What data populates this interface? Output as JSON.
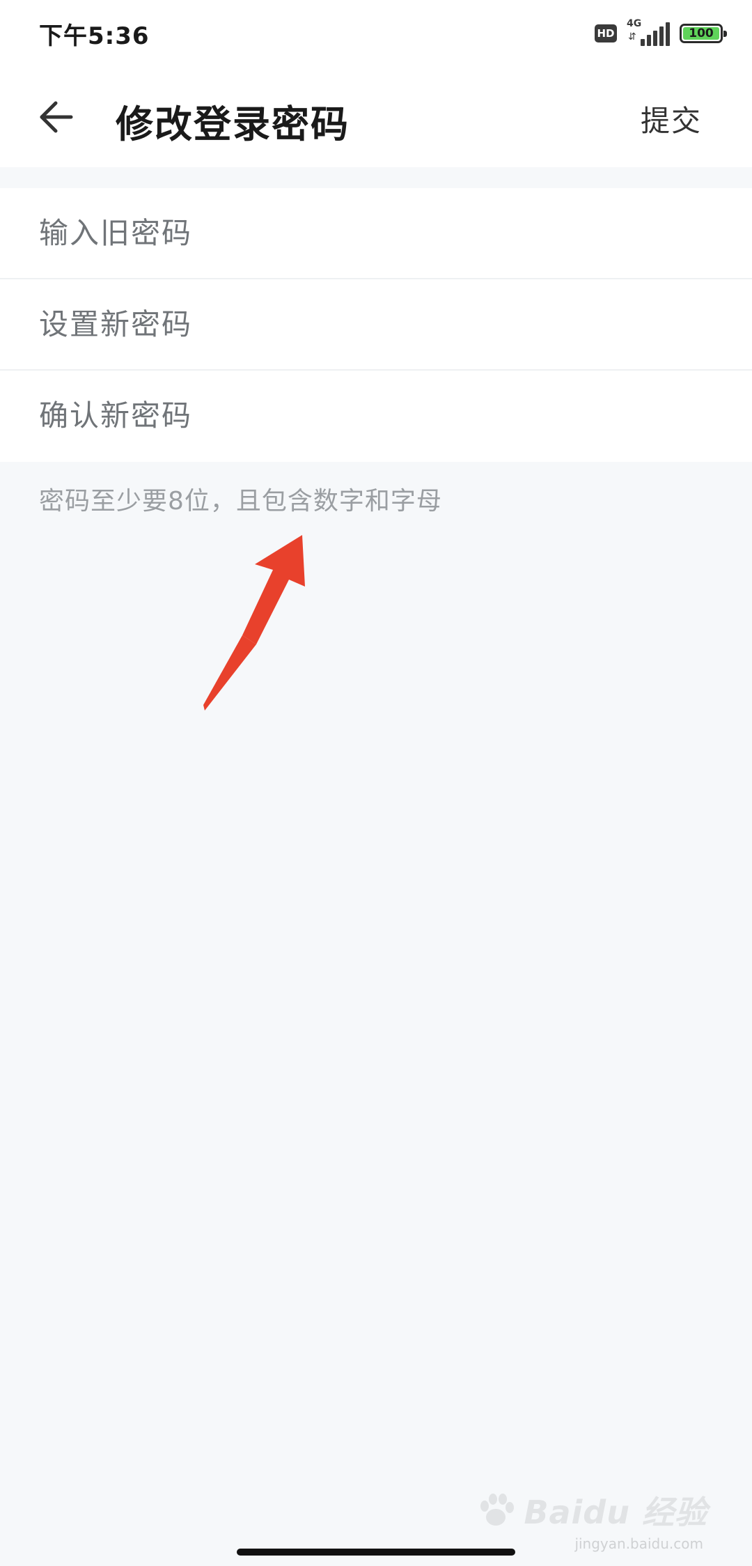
{
  "status_bar": {
    "time": "下午5:36",
    "hd_label": "HD",
    "network_label": "4G",
    "network_arrows": "⇵",
    "battery_level": "100"
  },
  "app_bar": {
    "title": "修改登录密码",
    "submit_label": "提交"
  },
  "form": {
    "old_password_placeholder": "输入旧密码",
    "new_password_placeholder": "设置新密码",
    "confirm_password_placeholder": "确认新密码"
  },
  "hint": "密码至少要8位，且包含数字和字母",
  "annotation": {
    "arrow_color": "#e8412c"
  },
  "watermark": {
    "text": "Baidu 经验",
    "sub": "jingyan.baidu.com"
  },
  "colors": {
    "background": "#f6f8fa",
    "surface": "#ffffff",
    "battery_green": "#5fd35a"
  }
}
